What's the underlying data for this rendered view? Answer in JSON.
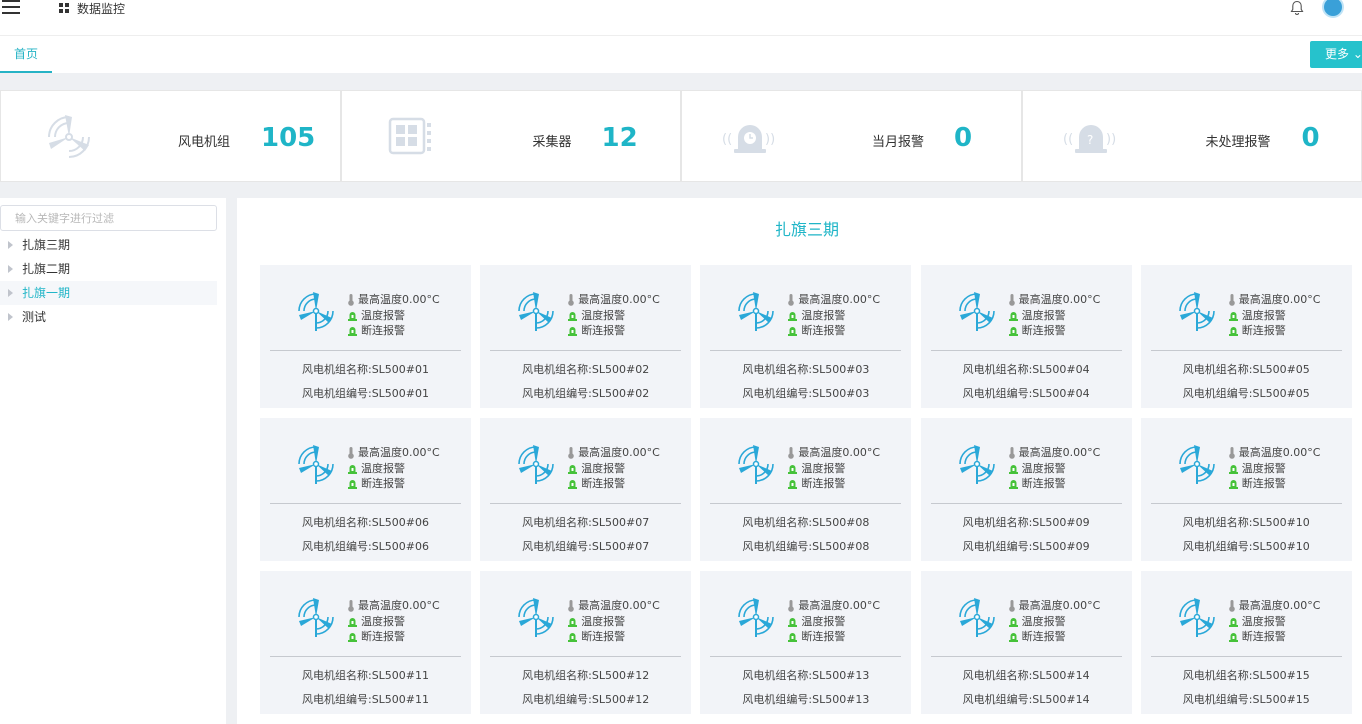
{
  "header": {
    "app_title": "数据监控",
    "icons": [
      "menu-icon",
      "grid-icon",
      "bell-icon",
      "avatar"
    ]
  },
  "tabs": {
    "home_label": "首页",
    "more_label": "更多"
  },
  "stats": [
    {
      "label": "风电机组",
      "value": "105",
      "icon": "wind-turbine-icon"
    },
    {
      "label": "采集器",
      "value": "12",
      "icon": "collector-icon"
    },
    {
      "label": "当月报警",
      "value": "0",
      "icon": "alarm-clock-icon"
    },
    {
      "label": "未处理报警",
      "value": "0",
      "icon": "unhandled-alarm-icon"
    }
  ],
  "sidebar": {
    "filter_placeholder": "输入关键字进行过滤",
    "items": [
      {
        "label": "扎旗三期",
        "active": false
      },
      {
        "label": "扎旗二期",
        "active": false
      },
      {
        "label": "扎旗一期",
        "active": true
      },
      {
        "label": "测试",
        "active": false
      }
    ]
  },
  "main": {
    "title": "扎旗三期",
    "card_labels": {
      "max_temp": "最高温度0.00°C",
      "temp_alarm": "温度报警",
      "disconnect_alarm": "断连报警"
    },
    "cards": [
      {
        "name": "风电机组名称:SL500#01",
        "code": "风电机组编号:SL500#01"
      },
      {
        "name": "风电机组名称:SL500#02",
        "code": "风电机组编号:SL500#02"
      },
      {
        "name": "风电机组名称:SL500#03",
        "code": "风电机组编号:SL500#03"
      },
      {
        "name": "风电机组名称:SL500#04",
        "code": "风电机组编号:SL500#04"
      },
      {
        "name": "风电机组名称:SL500#05",
        "code": "风电机组编号:SL500#05"
      },
      {
        "name": "风电机组名称:SL500#06",
        "code": "风电机组编号:SL500#06"
      },
      {
        "name": "风电机组名称:SL500#07",
        "code": "风电机组编号:SL500#07"
      },
      {
        "name": "风电机组名称:SL500#08",
        "code": "风电机组编号:SL500#08"
      },
      {
        "name": "风电机组名称:SL500#09",
        "code": "风电机组编号:SL500#09"
      },
      {
        "name": "风电机组名称:SL500#10",
        "code": "风电机组编号:SL500#10"
      },
      {
        "name": "风电机组名称:SL500#11",
        "code": "风电机组编号:SL500#11"
      },
      {
        "name": "风电机组名称:SL500#12",
        "code": "风电机组编号:SL500#12"
      },
      {
        "name": "风电机组名称:SL500#13",
        "code": "风电机组编号:SL500#13"
      },
      {
        "name": "风电机组名称:SL500#14",
        "code": "风电机组编号:SL500#14"
      },
      {
        "name": "风电机组名称:SL500#15",
        "code": "风电机组编号:SL500#15"
      }
    ]
  },
  "colors": {
    "accent": "#1fb5c7",
    "alarm_green": "#46c23a",
    "card_bg": "#f2f4f8"
  }
}
